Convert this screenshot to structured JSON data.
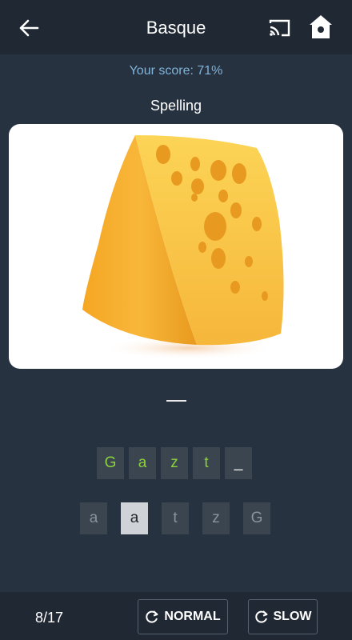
{
  "header": {
    "title": "Basque",
    "back_icon": "arrow-left-icon",
    "cast_icon": "cast-icon",
    "home_icon": "home-icon"
  },
  "score_text": "Your score: 71%",
  "mode_label": "Spelling",
  "image": {
    "subject": "cheese-image",
    "background": "#ffffff"
  },
  "answer_tiles": [
    "G",
    "a",
    "z",
    "t",
    "_"
  ],
  "choice_tiles": [
    "a",
    "a",
    "t",
    "z",
    "G"
  ],
  "footer": {
    "progress": "8/17",
    "normal_label": "NORMAL",
    "slow_label": "SLOW",
    "refresh_icon": "refresh-icon"
  },
  "colors": {
    "background": "#273240",
    "bar": "#1f2833",
    "score": "#7fb3d9",
    "correct_letter": "#8bd23b",
    "tile": "#3b4550"
  }
}
